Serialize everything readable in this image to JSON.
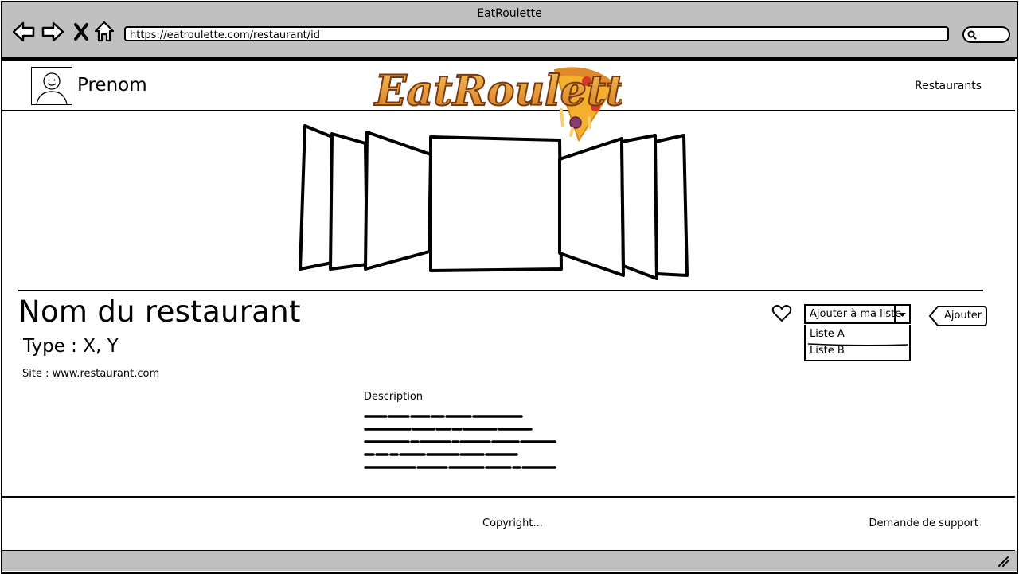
{
  "browser": {
    "window_title": "EatRoulette",
    "url": "https://eatroulette.com/restaurant/id",
    "nav_icons": [
      "back-arrow-icon",
      "forward-arrow-icon",
      "close-icon",
      "home-icon"
    ],
    "search_icon": "search-icon"
  },
  "header": {
    "user_name": "Prenom",
    "logo_text": "EatRoulette",
    "nav_link": "Restaurants"
  },
  "restaurant": {
    "name": "Nom du restaurant",
    "type": "Type : X, Y",
    "site": "Site : www.restaurant.com",
    "description_title": "Description"
  },
  "list_select": {
    "selected": "Ajouter à ma liste",
    "options": [
      "Liste A",
      "Liste B"
    ],
    "add_button": "Ajouter"
  },
  "footer": {
    "copyright": "Copyright...",
    "support": "Demande de support"
  }
}
